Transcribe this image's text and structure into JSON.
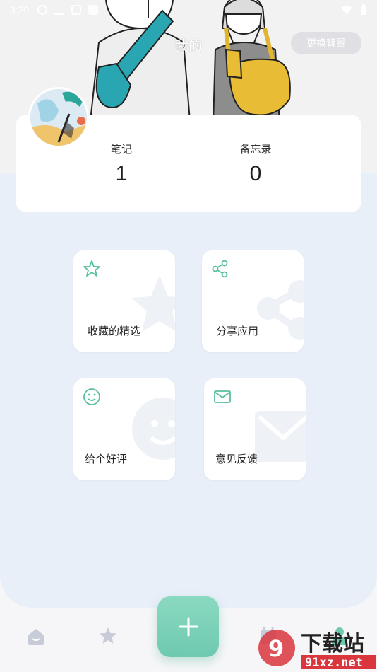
{
  "status_bar": {
    "time": "3:20"
  },
  "header": {
    "title": "我的",
    "change_bg_button": "更换背景"
  },
  "stats": [
    {
      "label": "笔记",
      "value": "1"
    },
    {
      "label": "备忘录",
      "value": "0"
    }
  ],
  "tiles": [
    {
      "label": "收藏的精选",
      "icon": "star-icon"
    },
    {
      "label": "分享应用",
      "icon": "share-icon"
    },
    {
      "label": "给个好评",
      "icon": "smiley-icon"
    },
    {
      "label": "意见反馈",
      "icon": "mail-icon"
    }
  ],
  "bottom_nav": {
    "items": [
      "home-icon",
      "star-icon",
      "calendar-icon",
      "profile-icon"
    ],
    "fab_icon": "plus-icon"
  },
  "watermark": {
    "text": "下载站",
    "url": "91xz.net"
  },
  "colors": {
    "accent": "#6ec9b0",
    "panel_bg": "#e9eff9",
    "icon_teal": "#58c0a0"
  }
}
